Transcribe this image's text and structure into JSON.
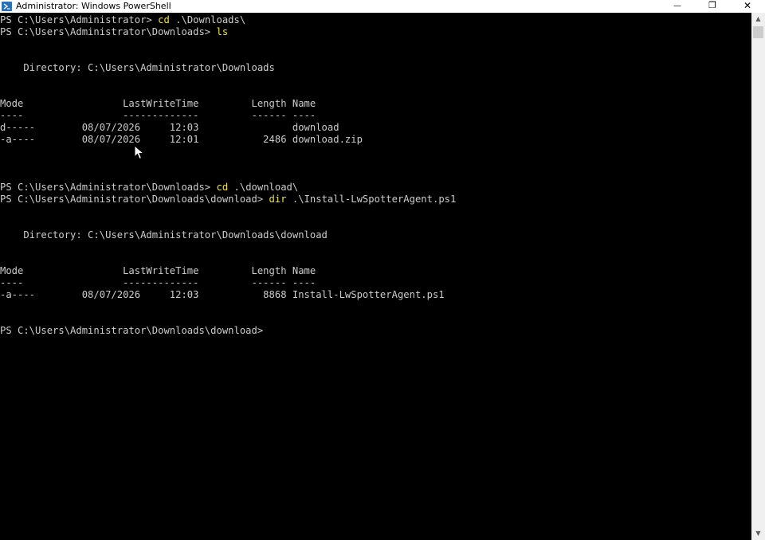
{
  "window": {
    "title": "Administrator: Windows PowerShell",
    "minimize_glyph": "—",
    "maximize_glyph": "❐",
    "close_glyph": "✕",
    "icon": "powershell-icon"
  },
  "terminal": {
    "lines": [
      {
        "prompt": "PS C:\\Users\\Administrator> ",
        "cmd": "cd",
        "args": " .\\Downloads\\"
      },
      {
        "prompt": "PS C:\\Users\\Administrator\\Downloads> ",
        "cmd": "ls",
        "args": ""
      },
      {
        "text": ""
      },
      {
        "text": ""
      },
      {
        "text": "    Directory: C:\\Users\\Administrator\\Downloads"
      },
      {
        "text": ""
      },
      {
        "text": ""
      },
      {
        "text": "Mode                 LastWriteTime         Length Name"
      },
      {
        "text": "----                 -------------         ------ ----"
      },
      {
        "text": "d-----        08/07/2026     12:03                download"
      },
      {
        "text": "-a----        08/07/2026     12:01           2486 download.zip"
      },
      {
        "text": ""
      },
      {
        "text": ""
      },
      {
        "text": ""
      },
      {
        "prompt": "PS C:\\Users\\Administrator\\Downloads> ",
        "cmd": "cd",
        "args": " .\\download\\"
      },
      {
        "prompt": "PS C:\\Users\\Administrator\\Downloads\\download> ",
        "cmd": "dir",
        "args": " .\\Install-LwSpotterAgent.ps1"
      },
      {
        "text": ""
      },
      {
        "text": ""
      },
      {
        "text": "    Directory: C:\\Users\\Administrator\\Downloads\\download"
      },
      {
        "text": ""
      },
      {
        "text": ""
      },
      {
        "text": "Mode                 LastWriteTime         Length Name"
      },
      {
        "text": "----                 -------------         ------ ----"
      },
      {
        "text": "-a----        08/07/2026     12:03           8868 Install-LwSpotterAgent.ps1"
      },
      {
        "text": ""
      },
      {
        "text": ""
      },
      {
        "prompt": "PS C:\\Users\\Administrator\\Downloads\\download> ",
        "cmd": "",
        "args": ""
      }
    ]
  },
  "scrollbar": {
    "up_glyph": "▲",
    "down_glyph": "▼"
  },
  "colors": {
    "background": "#000000",
    "text": "#cccccc",
    "command": "#f0e44a",
    "titlebar": "#ffffff"
  }
}
